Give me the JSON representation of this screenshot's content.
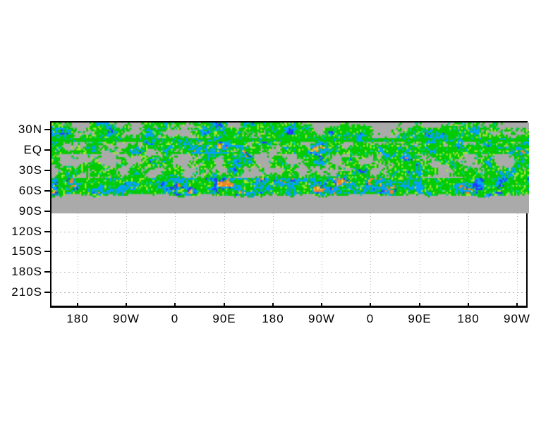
{
  "figure": {
    "background_color": "#ffffff",
    "frame_color": "#000000",
    "grid_color": "#b4b4b4",
    "grid_style": "dotted"
  },
  "chart_data": {
    "type": "heatmap",
    "title": "",
    "xlabel": "",
    "ylabel": "",
    "x_axis": {
      "tick_labels": [
        "180",
        "90W",
        "0",
        "90E",
        "180",
        "90W",
        "0",
        "90E",
        "180",
        "90W"
      ],
      "interval_degrees": 90,
      "note": "longitude axis repeating over more than two full circuits"
    },
    "y_axis": {
      "tick_labels": [
        "30N",
        "EQ",
        "30S",
        "60S",
        "90S",
        "120S",
        "150S",
        "180S",
        "210S"
      ],
      "interval": 30,
      "top_value": "40N",
      "note": "latitude-like axis continuing past 90S"
    },
    "legend": "none",
    "field": {
      "description": "Speckled shaded anomaly field (small grid cells) on a gray masked background occupying the band from ~40N to ~78S; solid gray strip continues to ~90S; region below 90S is blank white with dotted gridlines.",
      "masked_background": "#aaaaaa",
      "palette": [
        {
          "name": "green",
          "hex": "#00cc00",
          "weight": 0.42
        },
        {
          "name": "yellow-green",
          "hex": "#a0e632",
          "weight": 0.1
        },
        {
          "name": "aqua",
          "hex": "#00d28c",
          "weight": 0.05
        },
        {
          "name": "light-blue",
          "hex": "#00a0ff",
          "weight": 0.2
        },
        {
          "name": "dark-blue",
          "hex": "#1e3cff",
          "weight": 0.13
        },
        {
          "name": "orange",
          "hex": "#f08228",
          "weight": 0.07
        },
        {
          "name": "yellow",
          "hex": "#e6d233",
          "weight": 0.03
        }
      ],
      "seed": 20240613,
      "cols": 288,
      "rows": 43,
      "row_density_segments": [
        [
          0,
          2,
          0.52
        ],
        [
          3,
          8,
          0.6
        ],
        [
          9,
          10,
          0.82
        ],
        [
          11,
          13,
          0.58
        ],
        [
          14,
          17,
          0.68
        ],
        [
          18,
          24,
          0.52
        ],
        [
          25,
          31,
          0.55
        ],
        [
          32,
          40,
          0.86
        ],
        [
          41,
          41,
          0.55
        ],
        [
          42,
          42,
          0.3
        ]
      ],
      "green_stripe_rows": [
        9,
        10
      ],
      "orange_cluster_rows": [
        [
          12,
          20
        ],
        [
          30,
          42
        ]
      ]
    }
  }
}
